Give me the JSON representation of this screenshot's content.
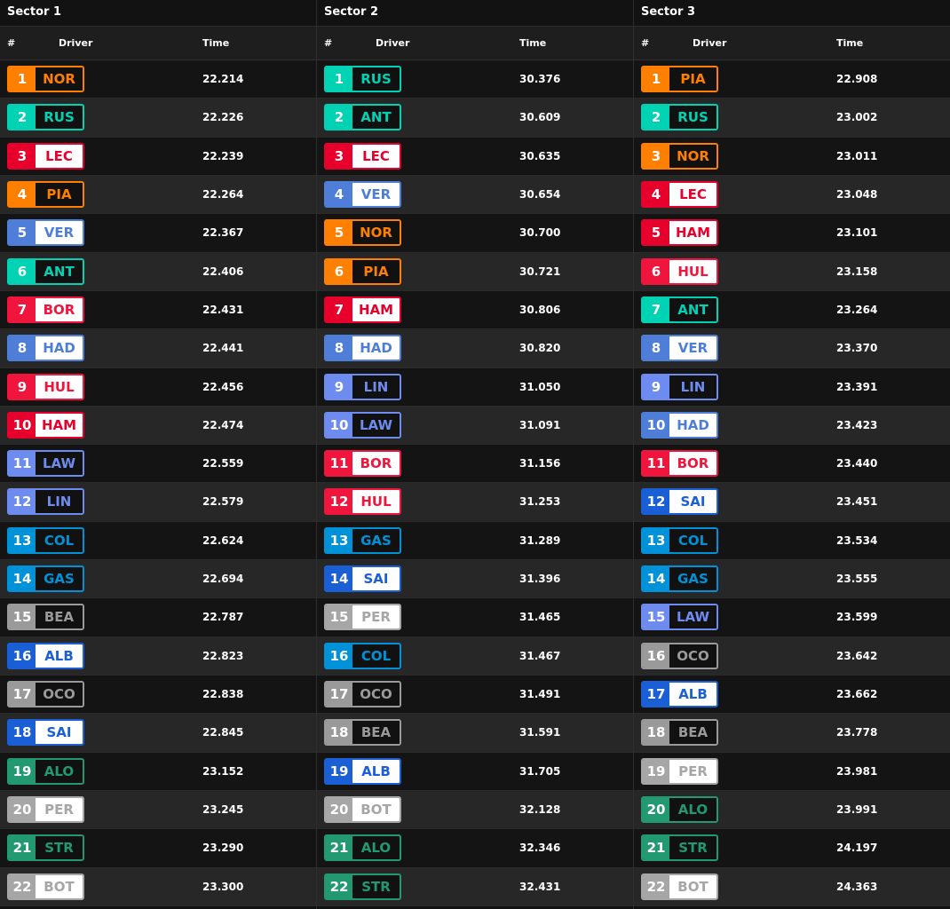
{
  "headers": {
    "pos": "#",
    "driver": "Driver",
    "time": "Time"
  },
  "teams": {
    "NOR": {
      "color": "#ff7f00",
      "fill": "dark"
    },
    "PIA": {
      "color": "#ff7f00",
      "fill": "dark"
    },
    "RUS": {
      "color": "#00d2b4",
      "fill": "dark"
    },
    "ANT": {
      "color": "#00d2b4",
      "fill": "dark"
    },
    "LEC": {
      "color": "#e8002d",
      "fill": "light"
    },
    "HAM": {
      "color": "#e8002d",
      "fill": "light"
    },
    "VER": {
      "color": "#4f7ed8",
      "fill": "light"
    },
    "HAD": {
      "color": "#4f7ed8",
      "fill": "light"
    },
    "BOR": {
      "color": "#f0153c",
      "fill": "light"
    },
    "HUL": {
      "color": "#f0153c",
      "fill": "light"
    },
    "LAW": {
      "color": "#6e8cf0",
      "fill": "dark"
    },
    "LIN": {
      "color": "#6e8cf0",
      "fill": "dark"
    },
    "COL": {
      "color": "#0092d8",
      "fill": "dark"
    },
    "GAS": {
      "color": "#0092d8",
      "fill": "dark"
    },
    "BEA": {
      "color": "#9a9a9a",
      "fill": "dark"
    },
    "OCO": {
      "color": "#9a9a9a",
      "fill": "dark"
    },
    "ALB": {
      "color": "#1a5fd6",
      "fill": "light"
    },
    "SAI": {
      "color": "#1a5fd6",
      "fill": "light"
    },
    "ALO": {
      "color": "#229971",
      "fill": "dark"
    },
    "STR": {
      "color": "#229971",
      "fill": "dark"
    },
    "PER": {
      "color": "#a6a6a6",
      "fill": "light"
    },
    "BOT": {
      "color": "#a6a6a6",
      "fill": "light"
    }
  },
  "sectors": [
    {
      "title": "Sector 1",
      "rows": [
        {
          "pos": "1",
          "code": "NOR",
          "time": "22.214"
        },
        {
          "pos": "2",
          "code": "RUS",
          "time": "22.226"
        },
        {
          "pos": "3",
          "code": "LEC",
          "time": "22.239"
        },
        {
          "pos": "4",
          "code": "PIA",
          "time": "22.264"
        },
        {
          "pos": "5",
          "code": "VER",
          "time": "22.367"
        },
        {
          "pos": "6",
          "code": "ANT",
          "time": "22.406"
        },
        {
          "pos": "7",
          "code": "BOR",
          "time": "22.431"
        },
        {
          "pos": "8",
          "code": "HAD",
          "time": "22.441"
        },
        {
          "pos": "9",
          "code": "HUL",
          "time": "22.456"
        },
        {
          "pos": "10",
          "code": "HAM",
          "time": "22.474"
        },
        {
          "pos": "11",
          "code": "LAW",
          "time": "22.559"
        },
        {
          "pos": "12",
          "code": "LIN",
          "time": "22.579"
        },
        {
          "pos": "13",
          "code": "COL",
          "time": "22.624"
        },
        {
          "pos": "14",
          "code": "GAS",
          "time": "22.694"
        },
        {
          "pos": "15",
          "code": "BEA",
          "time": "22.787"
        },
        {
          "pos": "16",
          "code": "ALB",
          "time": "22.823"
        },
        {
          "pos": "17",
          "code": "OCO",
          "time": "22.838"
        },
        {
          "pos": "18",
          "code": "SAI",
          "time": "22.845"
        },
        {
          "pos": "19",
          "code": "ALO",
          "time": "23.152"
        },
        {
          "pos": "20",
          "code": "PER",
          "time": "23.245"
        },
        {
          "pos": "21",
          "code": "STR",
          "time": "23.290"
        },
        {
          "pos": "22",
          "code": "BOT",
          "time": "23.300"
        }
      ]
    },
    {
      "title": "Sector 2",
      "rows": [
        {
          "pos": "1",
          "code": "RUS",
          "time": "30.376"
        },
        {
          "pos": "2",
          "code": "ANT",
          "time": "30.609"
        },
        {
          "pos": "3",
          "code": "LEC",
          "time": "30.635"
        },
        {
          "pos": "4",
          "code": "VER",
          "time": "30.654"
        },
        {
          "pos": "5",
          "code": "NOR",
          "time": "30.700"
        },
        {
          "pos": "6",
          "code": "PIA",
          "time": "30.721"
        },
        {
          "pos": "7",
          "code": "HAM",
          "time": "30.806"
        },
        {
          "pos": "8",
          "code": "HAD",
          "time": "30.820"
        },
        {
          "pos": "9",
          "code": "LIN",
          "time": "31.050"
        },
        {
          "pos": "10",
          "code": "LAW",
          "time": "31.091"
        },
        {
          "pos": "11",
          "code": "BOR",
          "time": "31.156"
        },
        {
          "pos": "12",
          "code": "HUL",
          "time": "31.253"
        },
        {
          "pos": "13",
          "code": "GAS",
          "time": "31.289"
        },
        {
          "pos": "14",
          "code": "SAI",
          "time": "31.396"
        },
        {
          "pos": "15",
          "code": "PER",
          "time": "31.465"
        },
        {
          "pos": "16",
          "code": "COL",
          "time": "31.467"
        },
        {
          "pos": "17",
          "code": "OCO",
          "time": "31.491"
        },
        {
          "pos": "18",
          "code": "BEA",
          "time": "31.591"
        },
        {
          "pos": "19",
          "code": "ALB",
          "time": "31.705"
        },
        {
          "pos": "20",
          "code": "BOT",
          "time": "32.128"
        },
        {
          "pos": "21",
          "code": "ALO",
          "time": "32.346"
        },
        {
          "pos": "22",
          "code": "STR",
          "time": "32.431"
        }
      ]
    },
    {
      "title": "Sector 3",
      "rows": [
        {
          "pos": "1",
          "code": "PIA",
          "time": "22.908"
        },
        {
          "pos": "2",
          "code": "RUS",
          "time": "23.002"
        },
        {
          "pos": "3",
          "code": "NOR",
          "time": "23.011"
        },
        {
          "pos": "4",
          "code": "LEC",
          "time": "23.048"
        },
        {
          "pos": "5",
          "code": "HAM",
          "time": "23.101"
        },
        {
          "pos": "6",
          "code": "HUL",
          "time": "23.158"
        },
        {
          "pos": "7",
          "code": "ANT",
          "time": "23.264"
        },
        {
          "pos": "8",
          "code": "VER",
          "time": "23.370"
        },
        {
          "pos": "9",
          "code": "LIN",
          "time": "23.391"
        },
        {
          "pos": "10",
          "code": "HAD",
          "time": "23.423"
        },
        {
          "pos": "11",
          "code": "BOR",
          "time": "23.440"
        },
        {
          "pos": "12",
          "code": "SAI",
          "time": "23.451"
        },
        {
          "pos": "13",
          "code": "COL",
          "time": "23.534"
        },
        {
          "pos": "14",
          "code": "GAS",
          "time": "23.555"
        },
        {
          "pos": "15",
          "code": "LAW",
          "time": "23.599"
        },
        {
          "pos": "16",
          "code": "OCO",
          "time": "23.642"
        },
        {
          "pos": "17",
          "code": "ALB",
          "time": "23.662"
        },
        {
          "pos": "18",
          "code": "BEA",
          "time": "23.778"
        },
        {
          "pos": "19",
          "code": "PER",
          "time": "23.981"
        },
        {
          "pos": "20",
          "code": "ALO",
          "time": "23.991"
        },
        {
          "pos": "21",
          "code": "STR",
          "time": "24.197"
        },
        {
          "pos": "22",
          "code": "BOT",
          "time": "24.363"
        }
      ]
    }
  ]
}
